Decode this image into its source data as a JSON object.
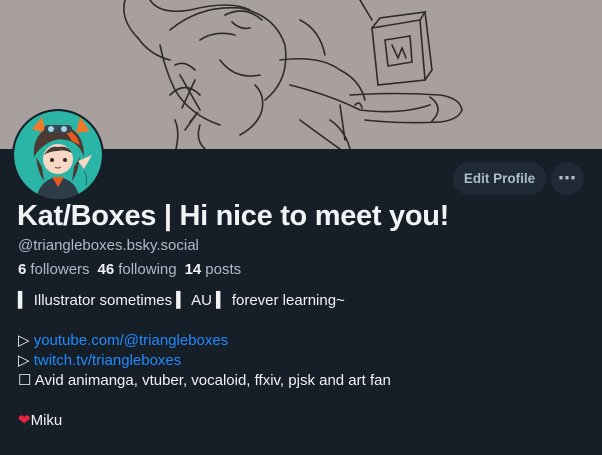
{
  "profile": {
    "display_name": "Kat/Boxes | Hi nice to meet you!",
    "handle": "@triangleboxes.bsky.social",
    "edit_label": "Edit Profile",
    "more_label": "⋯",
    "stats": {
      "followers_count": "6",
      "followers_label": "followers",
      "following_count": "46",
      "following_label": "following",
      "posts_count": "14",
      "posts_label": "posts"
    },
    "bio": {
      "line1": "▍ Illustrator sometimes ▍ AU ▍ forever learning~",
      "line3_prefix": "▷ ",
      "youtube_link": "youtube.com/@triangleboxes",
      "line4_prefix": "▷ ",
      "twitch_link": "twitch.tv/triangleboxes",
      "line5": "☐ Avid animanga, vtuber, vocaloid, ffxiv, pjsk and art fan",
      "heart": "❤",
      "line7": "Miku"
    }
  },
  "colors": {
    "background": "#161e27",
    "link": "#208bfe",
    "muted": "#aebbc9",
    "button_bg": "#1f2a36",
    "banner_bg": "#a7a09f",
    "avatar_bg": "#2bb5a6"
  },
  "icons": {
    "more": "ellipsis-icon",
    "heart": "heart-icon"
  }
}
